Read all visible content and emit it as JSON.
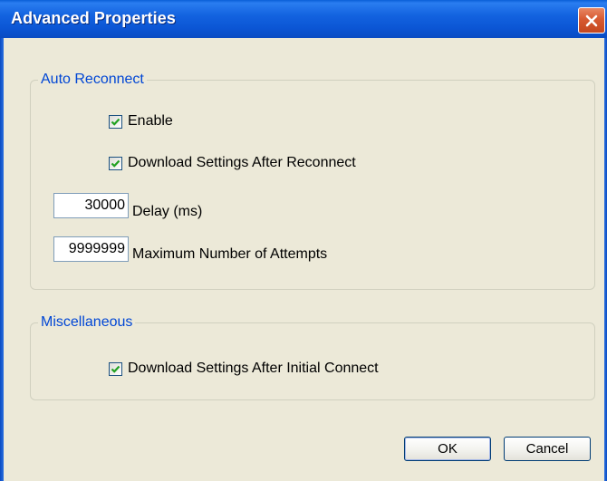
{
  "window": {
    "title": "Advanced Properties",
    "close_icon": "close-icon"
  },
  "auto_reconnect": {
    "legend": "Auto Reconnect",
    "enable": {
      "label": "Enable",
      "checked": true
    },
    "download_settings": {
      "label": "Download Settings After Reconnect",
      "checked": true
    },
    "delay": {
      "value": "30000",
      "label": "Delay (ms)"
    },
    "max_attempts": {
      "value": "9999999",
      "label": "Maximum Number of Attempts"
    }
  },
  "miscellaneous": {
    "legend": "Miscellaneous",
    "download_initial": {
      "label": "Download Settings After Initial Connect",
      "checked": true
    }
  },
  "buttons": {
    "ok_label": "OK",
    "cancel_label": "Cancel"
  },
  "colors": {
    "titlebar": "#0b55d4",
    "legend_text": "#0046d5",
    "check_mark": "#21a121",
    "close_button": "#d75a32"
  }
}
